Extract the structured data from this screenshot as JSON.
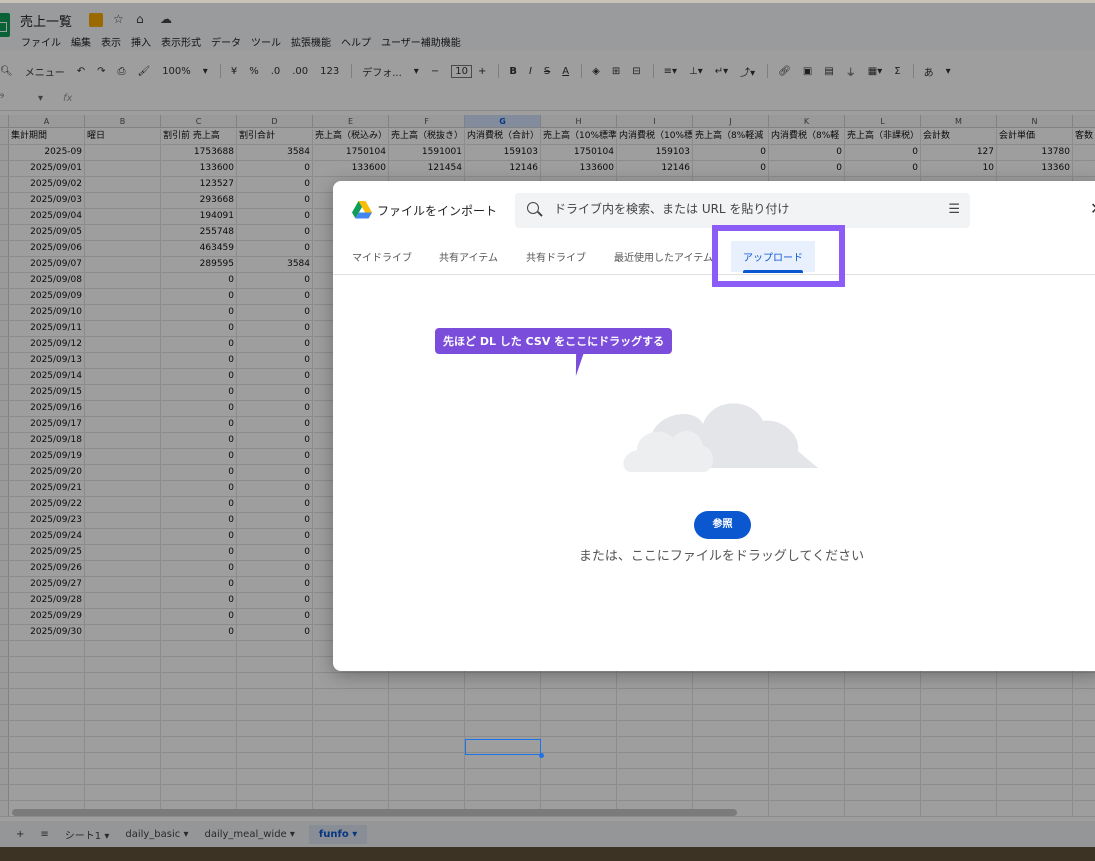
{
  "doc": {
    "title": "売上一覧",
    "menu": [
      "ファイル",
      "編集",
      "表示",
      "挿入",
      "表示形式",
      "データ",
      "ツール",
      "拡張機能",
      "ヘルプ",
      "ユーザー補助機能"
    ]
  },
  "toolbar": {
    "menus_search": "メニュー",
    "zoom": "100%",
    "currency": "¥",
    "percent": "%",
    "dec_decrease": ".0",
    "dec_increase": ".00",
    "format_123": "123",
    "font": "デフォ...",
    "font_size": "10",
    "input_tool": "あ"
  },
  "formula_bar": {
    "fx": "fx"
  },
  "sheet": {
    "columns": [
      "A",
      "B",
      "C",
      "D",
      "E",
      "F",
      "G",
      "H",
      "I",
      "J",
      "K",
      "L",
      "M",
      "N"
    ],
    "selected_column": "G",
    "header_row": [
      "集計期間",
      "曜日",
      "割引前 売上高",
      "割引合計",
      "売上高（税込み）",
      "売上高（税抜き）",
      "内消費税（合計）",
      "売上高（10%標準",
      "内消費税（10%標",
      "売上高（8%軽減",
      "内消費税（8%軽",
      "売上高（非課税）",
      "会計数",
      "会計単価",
      "客数"
    ],
    "rows": [
      [
        "2025-09",
        "",
        "1753688",
        "3584",
        "1750104",
        "1591001",
        "159103",
        "1750104",
        "159103",
        "0",
        "0",
        "0",
        "127",
        "13780"
      ],
      [
        "2025/09/01",
        "",
        "133600",
        "0",
        "133600",
        "121454",
        "12146",
        "133600",
        "12146",
        "0",
        "0",
        "0",
        "10",
        "13360"
      ],
      [
        "2025/09/02",
        "",
        "123527",
        "0"
      ],
      [
        "2025/09/03",
        "",
        "293668",
        "0"
      ],
      [
        "2025/09/04",
        "",
        "194091",
        "0"
      ],
      [
        "2025/09/05",
        "",
        "255748",
        "0"
      ],
      [
        "2025/09/06",
        "",
        "463459",
        "0"
      ],
      [
        "2025/09/07",
        "",
        "289595",
        "3584"
      ],
      [
        "2025/09/08",
        "",
        "0",
        "0"
      ],
      [
        "2025/09/09",
        "",
        "0",
        "0"
      ],
      [
        "2025/09/10",
        "",
        "0",
        "0"
      ],
      [
        "2025/09/11",
        "",
        "0",
        "0"
      ],
      [
        "2025/09/12",
        "",
        "0",
        "0"
      ],
      [
        "2025/09/13",
        "",
        "0",
        "0"
      ],
      [
        "2025/09/14",
        "",
        "0",
        "0"
      ],
      [
        "2025/09/15",
        "",
        "0",
        "0"
      ],
      [
        "2025/09/16",
        "",
        "0",
        "0"
      ],
      [
        "2025/09/17",
        "",
        "0",
        "0"
      ],
      [
        "2025/09/18",
        "",
        "0",
        "0"
      ],
      [
        "2025/09/19",
        "",
        "0",
        "0"
      ],
      [
        "2025/09/20",
        "",
        "0",
        "0"
      ],
      [
        "2025/09/21",
        "",
        "0",
        "0"
      ],
      [
        "2025/09/22",
        "",
        "0",
        "0"
      ],
      [
        "2025/09/23",
        "",
        "0",
        "0"
      ],
      [
        "2025/09/24",
        "",
        "0",
        "0"
      ],
      [
        "2025/09/25",
        "",
        "0",
        "0"
      ],
      [
        "2025/09/26",
        "",
        "0",
        "0"
      ],
      [
        "2025/09/27",
        "",
        "0",
        "0"
      ],
      [
        "2025/09/28",
        "",
        "0",
        "0"
      ],
      [
        "2025/09/29",
        "",
        "0",
        "0"
      ],
      [
        "2025/09/30",
        "",
        "0",
        "0"
      ]
    ]
  },
  "sheet_tabs": [
    "シート1",
    "daily_basic",
    "daily_meal_wide",
    "funfo"
  ],
  "active_sheet": "funfo",
  "modal": {
    "title": "ファイルをインポート",
    "search_placeholder": "ドライブ内を検索、または URL を貼り付け",
    "tabs": [
      "マイドライブ",
      "共有アイテム",
      "共有ドライブ",
      "最近使用したアイテム",
      "アップロード"
    ],
    "active_tab": "アップロード",
    "callout": "先ほど DL した CSV をここにドラッグする",
    "browse_label": "参照",
    "drop_text": "または、ここにファイルをドラッグしてください"
  },
  "colors": {
    "accent": "#0b57d0",
    "callout": "#7b4ddb",
    "frame": "#8b5cf6",
    "sheets_green": "#0f9d58"
  }
}
